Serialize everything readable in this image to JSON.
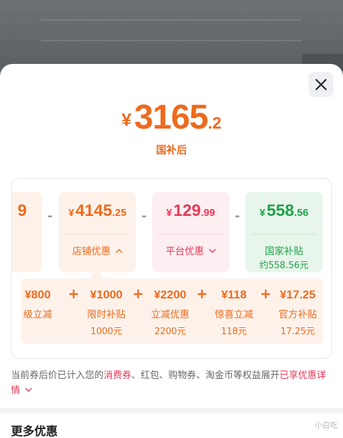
{
  "header": {
    "price_yen": "¥",
    "price_int": "3165",
    "price_dec": ".2",
    "price_label": "国补后"
  },
  "cards": {
    "cut": {
      "amount_int": "9"
    },
    "store": {
      "yen": "¥",
      "amount_int": "4145",
      "amount_dec": ".25",
      "label": "店铺优惠"
    },
    "platform": {
      "yen": "¥",
      "amount_int": "129",
      "amount_dec": ".99",
      "label": "平台优惠"
    },
    "gov": {
      "yen": "¥",
      "amount_int": "558",
      "amount_dec": ".56",
      "label": "国家补贴",
      "sub_label": "约558.56元"
    },
    "minus": "-"
  },
  "store_breakdown": [
    {
      "value": "¥800",
      "name": "级立减",
      "sub": ""
    },
    {
      "value": "¥1000",
      "name": "限时补贴",
      "sub": "1000元"
    },
    {
      "value": "¥2200",
      "name": "立减优惠",
      "sub": "2200元"
    },
    {
      "value": "¥118",
      "name": "惊喜立减",
      "sub": "118元"
    },
    {
      "value": "¥17.25",
      "name": "官方补贴",
      "sub": "17.25元"
    }
  ],
  "plus": "+",
  "note": {
    "prefix": "当前券后价已计入您的",
    "highlight": "消费券",
    "middle": "、红包、购物券、淘金币等权益展开",
    "link": "已享优惠详情"
  },
  "more_title": "更多优惠",
  "watermark": "小白吃"
}
